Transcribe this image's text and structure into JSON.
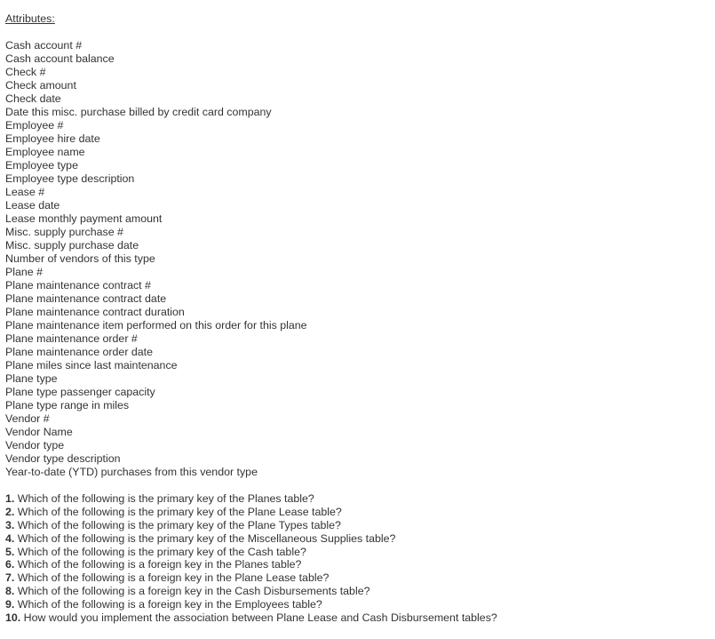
{
  "heading": "Attributes:",
  "attributes": [
    "Cash account #",
    "Cash account balance",
    "Check #",
    "Check amount",
    "Check date",
    "Date this misc. purchase billed by credit card company",
    "Employee #",
    "Employee hire date",
    "Employee name",
    "Employee type",
    "Employee type description",
    "Lease #",
    "Lease date",
    "Lease monthly payment amount",
    "Misc. supply purchase #",
    "Misc. supply purchase date",
    "Number of vendors of this type",
    "Plane #",
    "Plane maintenance contract #",
    "Plane maintenance contract date",
    "Plane maintenance contract duration",
    "Plane maintenance item performed on this order for this plane",
    "Plane maintenance order #",
    "Plane maintenance order date",
    "Plane miles since last maintenance",
    "Plane type",
    "Plane type passenger capacity",
    "Plane type range in miles",
    "Vendor #",
    "Vendor Name",
    "Vendor type",
    "Vendor type description",
    "Year-to-date (YTD) purchases from this vendor type"
  ],
  "questions": [
    {
      "number": "1.",
      "text": " Which of the following is the primary key of the Planes table?"
    },
    {
      "number": "2.",
      "text": " Which of the following is the primary key of the Plane Lease table?"
    },
    {
      "number": "3.",
      "text": " Which of the following is the primary key of the Plane Types table?"
    },
    {
      "number": "4.",
      "text": " Which of the following is the primary key of the Miscellaneous Supplies table?"
    },
    {
      "number": "5.",
      "text": " Which of the following is the primary key of the Cash table?"
    },
    {
      "number": "6.",
      "text": " Which of the following is a foreign key in the Planes table?"
    },
    {
      "number": "7.",
      "text": " Which of the following is a foreign key in the Plane Lease table?"
    },
    {
      "number": "8.",
      "text": " Which of the following is a foreign key in the Cash Disbursements table?"
    },
    {
      "number": "9.",
      "text": " Which of the following is a foreign key in the Employees table?"
    },
    {
      "number": "10.",
      "text": " How would you implement the association between Plane Lease and Cash Disbursement tables?"
    }
  ]
}
